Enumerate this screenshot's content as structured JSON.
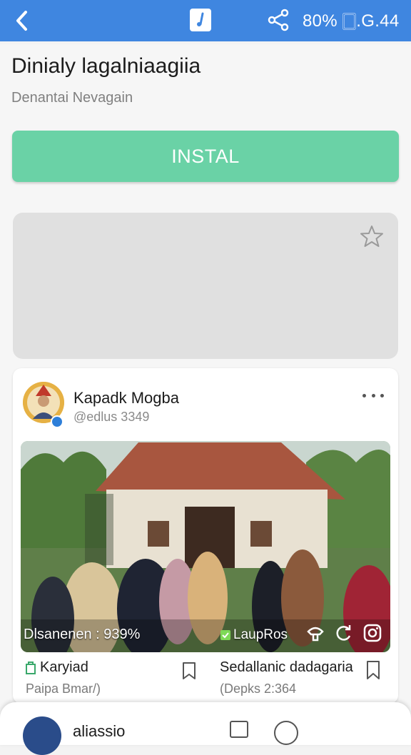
{
  "topbar": {
    "back_icon": "chevron-left-icon",
    "app_icon": "music-note-icon",
    "share_icon": "share-icon",
    "status_text": "80% 🀆.G.44"
  },
  "app": {
    "title": "Dinialy lagalniaagiia",
    "developer": "Denantai Nevagain",
    "install_label": "INSTAL",
    "install_color": "#6ad2a6",
    "placeholder_icon": "star-outline-icon"
  },
  "post": {
    "name": "Kapadk Mogba",
    "handle": "@edlus 3349",
    "more_icon": "more-horizontal-icon",
    "caption_left": "Dlsanenen : 939%",
    "caption_mid": "LaupRos",
    "photo_icons": [
      "hat-icon",
      "refresh-icon",
      "instagram-icon"
    ],
    "footer_left_title": "Karyiad",
    "footer_left_sub": "Paipa Bmar/)",
    "footer_right_title": "Sedallanic dadagaria",
    "footer_right_sub": "(Depks 2:364"
  },
  "bottom": {
    "name": "aliassio"
  },
  "colors": {
    "topbar": "#3f86e0",
    "install": "#6ad2a6",
    "placeholder": "#e0e0e0"
  }
}
